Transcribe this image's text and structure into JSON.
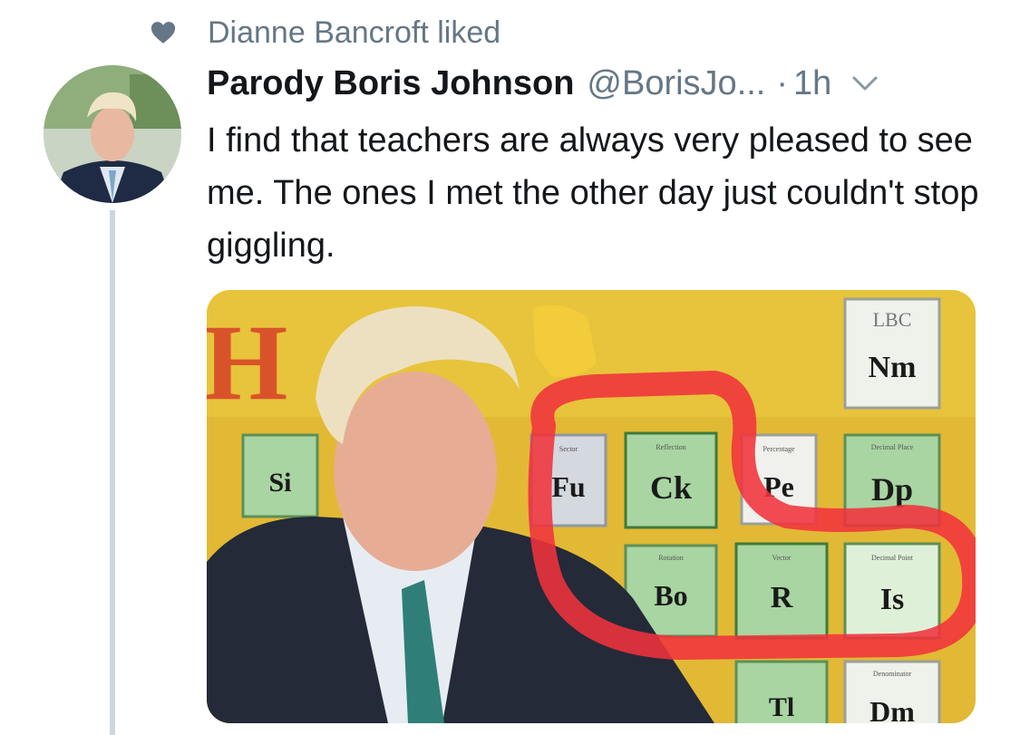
{
  "social_context": {
    "icon": "heart-icon",
    "text": "Dianne Bancroft liked"
  },
  "tweet": {
    "author_name": "Parody Boris Johnson",
    "handle": "@BorisJo...",
    "separator": "·",
    "time": "1h",
    "text": "I find that teachers are always very pleased to see me. The ones I met the other day just couldn't stop giggling.",
    "menu_icon": "chevron-down-icon"
  },
  "media": {
    "elements": [
      {
        "symbol": "Si",
        "label": ""
      },
      {
        "symbol": "Fu",
        "label": "Sector"
      },
      {
        "symbol": "Ck",
        "label": "Reflection"
      },
      {
        "symbol": "Pe",
        "label": "Percentage"
      },
      {
        "symbol": "Dp",
        "label": "Decimal Place"
      },
      {
        "symbol": "Nm",
        "label": ""
      },
      {
        "symbol": "Bo",
        "label": "Rotation"
      },
      {
        "symbol": "R",
        "label": "Vector"
      },
      {
        "symbol": "Is",
        "label": "Decimal Point"
      },
      {
        "symbol": "Tl",
        "label": ""
      },
      {
        "symbol": "Dm",
        "label": "Denominator"
      }
    ],
    "corner_letter": "H",
    "watermark": "LBC"
  },
  "colors": {
    "text_primary": "#14171a",
    "text_secondary": "#657786",
    "thread_line": "#ccd6dd",
    "highlight": "#f0323c",
    "board_yellow": "#e7c43b",
    "cell_green": "#a8d5a2"
  }
}
